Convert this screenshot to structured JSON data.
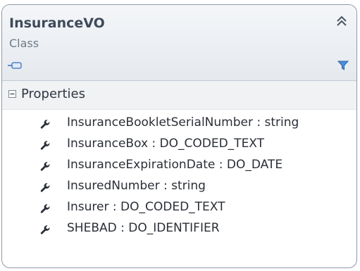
{
  "class": {
    "name": "InsuranceVO",
    "stereotype": "Class"
  },
  "icons": {
    "collapse": "double-chevron-up-icon",
    "class_glyph": "class-shape-icon",
    "filter": "filter-funnel-icon",
    "expander": "minus-box-icon",
    "property": "wrench-property-icon"
  },
  "section": {
    "title": "Properties"
  },
  "properties": [
    {
      "label": "InsuranceBookletSerialNumber : string"
    },
    {
      "label": "InsuranceBox : DO_CODED_TEXT"
    },
    {
      "label": "InsuranceExpirationDate : DO_DATE"
    },
    {
      "label": "InsuredNumber : string"
    },
    {
      "label": "Insurer : DO_CODED_TEXT"
    },
    {
      "label": "SHEBAD : DO_IDENTIFIER"
    }
  ],
  "colors": {
    "border": "#8e9aa8",
    "header_gradient_top": "#f4f6f9",
    "header_gradient_bottom": "#e5e9ee",
    "title_text": "#3e4a5a",
    "icon_blue": "#3a7bd5"
  }
}
